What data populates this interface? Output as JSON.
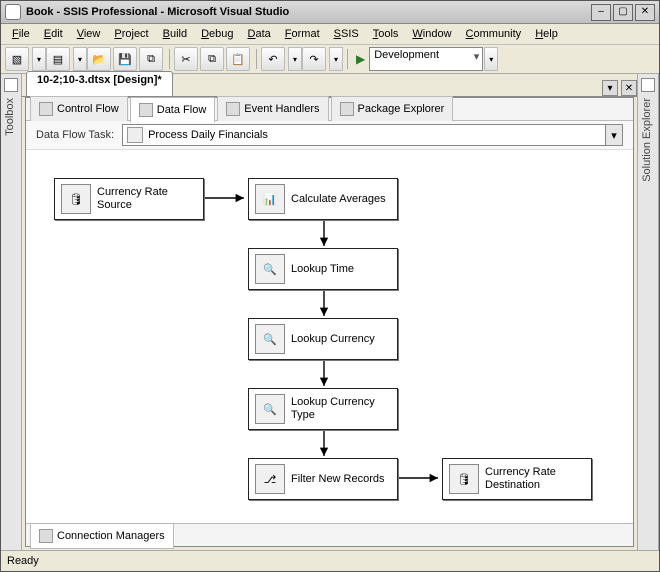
{
  "window": {
    "title": "Book - SSIS Professional - Microsoft Visual Studio"
  },
  "menu": [
    {
      "u": "F",
      "r": "ile"
    },
    {
      "u": "E",
      "r": "dit"
    },
    {
      "u": "V",
      "r": "iew"
    },
    {
      "u": "P",
      "r": "roject"
    },
    {
      "u": "B",
      "r": "uild"
    },
    {
      "u": "D",
      "r": "ebug"
    },
    {
      "u": "D",
      "r": "ata"
    },
    {
      "u": "F",
      "r": "ormat"
    },
    {
      "u": "S",
      "r": "SIS"
    },
    {
      "u": "T",
      "r": "ools"
    },
    {
      "u": "W",
      "r": "indow"
    },
    {
      "u": "C",
      "r": "ommunity"
    },
    {
      "u": "H",
      "r": "elp"
    }
  ],
  "toolbar": {
    "config": "Development"
  },
  "side": {
    "left": "Toolbox",
    "right": "Solution Explorer"
  },
  "doc": {
    "tab": "10-2;10-3.dtsx [Design]*"
  },
  "designer": {
    "tabs": [
      "Control Flow",
      "Data Flow",
      "Event Handlers",
      "Package Explorer"
    ],
    "task_label": "Data Flow Task:",
    "task_value": "Process Daily Financials",
    "nodes": [
      "Currency Rate Source",
      "Calculate Averages",
      "Lookup Time",
      "Lookup Currency",
      "Lookup Currency Type",
      "Filter New Records",
      "Currency Rate Destination"
    ],
    "bottom_tab": "Connection Managers"
  },
  "status": {
    "text": "Ready"
  }
}
